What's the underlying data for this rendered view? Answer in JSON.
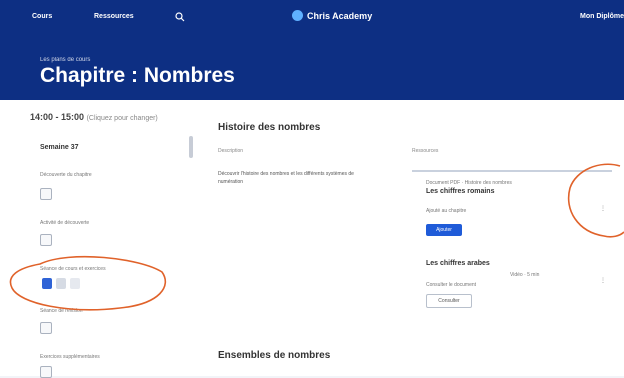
{
  "topbar": {
    "nav1": "Cours",
    "nav2": "Ressources",
    "brand": "Chris Academy",
    "user": "Mon Diplôme"
  },
  "header": {
    "breadcrumb": "Les plans de cours",
    "title": "Chapitre : Nombres"
  },
  "sidebar": {
    "time": "14:00 - 15:00",
    "time_note": "(Cliquez pour changer)",
    "section": "Semaine 37",
    "items": [
      {
        "label": "Découverte du chapitre"
      },
      {
        "label": "Activité de découverte"
      },
      {
        "label": "Séance de cours et exercices"
      },
      {
        "label": "Séance de révision"
      },
      {
        "label": "Exercices supplémentaires"
      }
    ]
  },
  "main": {
    "card1_title": "Histoire des nombres",
    "col_left": "Description",
    "col_right": "Ressources",
    "description": "Découvrir l'histoire des nombres et les différents systèmes de numération",
    "res1_meta": "Document PDF · Histoire des nombres",
    "res1_title": "Les chiffres romains",
    "res1_sub": "Ajouté au chapitre",
    "res1_button": "Ajouter",
    "res2_title": "Les chiffres arabes",
    "res2_meta": "Vidéo · 5 min",
    "res2_sub": "Consulter le document",
    "res2_button": "Consulter",
    "card2_title": "Ensembles de nombres"
  },
  "colors": {
    "brand_blue": "#0d2f83",
    "primary_button": "#1f5bd8",
    "annotation": "#e0622a"
  }
}
